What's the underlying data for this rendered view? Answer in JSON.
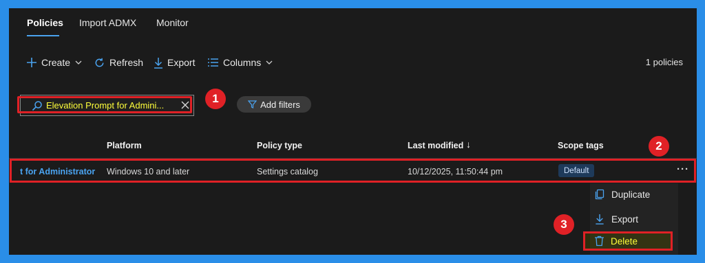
{
  "tabs": [
    {
      "label": "Policies",
      "active": true
    },
    {
      "label": "Import ADMX",
      "active": false
    },
    {
      "label": "Monitor",
      "active": false
    }
  ],
  "toolbar": {
    "create_label": "Create",
    "refresh_label": "Refresh",
    "export_label": "Export",
    "columns_label": "Columns",
    "policy_count": "1 policies"
  },
  "search": {
    "value": "Elevation Prompt for Admini..."
  },
  "filters": {
    "add_label": "Add filters"
  },
  "callouts": {
    "one": "1",
    "two": "2",
    "three": "3"
  },
  "table": {
    "headers": {
      "platform": "Platform",
      "policy_type": "Policy type",
      "last_modified": "Last modified",
      "scope_tags": "Scope tags"
    },
    "sort_indicator": "↓",
    "rows": [
      {
        "name": "t for Administrator",
        "platform": "Windows 10 and later",
        "policy_type": "Settings catalog",
        "last_modified": "10/12/2025, 11:50:44 pm",
        "scope_tag": "Default",
        "more": "···"
      }
    ]
  },
  "context_menu": {
    "items": [
      {
        "label": "Duplicate",
        "icon": "duplicate-icon"
      },
      {
        "label": "Export",
        "icon": "download-icon"
      },
      {
        "label": "Delete",
        "icon": "trash-icon"
      }
    ]
  },
  "colors": {
    "accent": "#4aa3f0",
    "highlight_red": "#e02126",
    "search_text": "#ffff3a",
    "background": "#1b1b1b",
    "border_frame": "#2a8ee8"
  }
}
